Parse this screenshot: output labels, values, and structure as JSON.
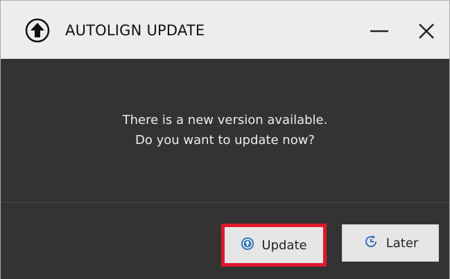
{
  "window": {
    "title": "AUTOLIGN UPDATE",
    "title_icon": "upload-arrow-icon",
    "controls": {
      "minimize_icon": "minimize-icon",
      "close_icon": "close-icon"
    }
  },
  "message": {
    "line1": "There is a new version available.",
    "line2": "Do you want to update now?"
  },
  "buttons": {
    "update": {
      "label": "Update",
      "icon": "upload-circle-icon",
      "highlight_color": "#e0192b"
    },
    "later": {
      "label": "Later",
      "icon": "clock-refresh-icon"
    }
  },
  "colors": {
    "titlebar": "#ededed",
    "body": "#333333",
    "text": "#ececec",
    "button": "#e6e6e6",
    "highlight": "#e0192b"
  }
}
